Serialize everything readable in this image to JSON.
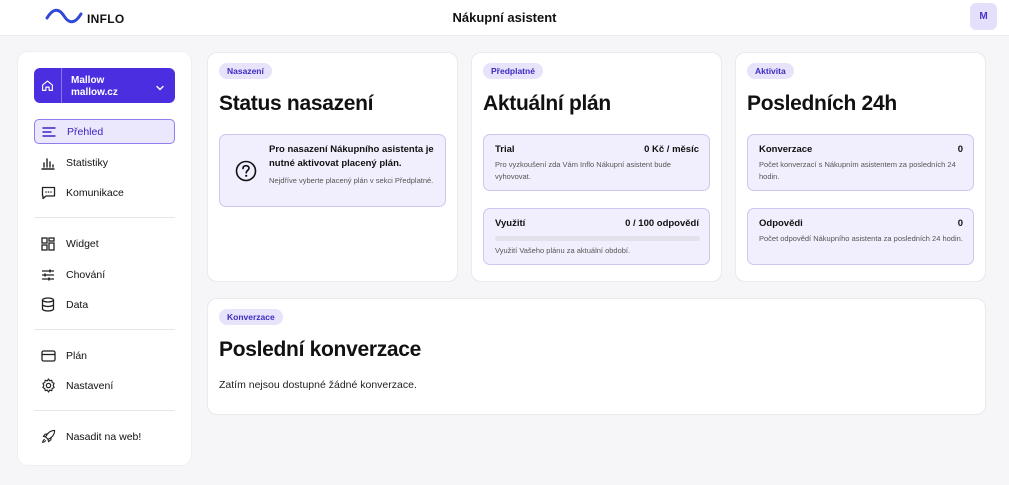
{
  "header": {
    "logo_text": "INFLO",
    "page_title": "Nákupní asistent",
    "avatar_initial": "M"
  },
  "sidebar": {
    "account": {
      "name": "Mallow",
      "domain": "mallow.cz"
    },
    "items": [
      {
        "label": "Přehled",
        "icon": "menu-lines-icon",
        "active": true
      },
      {
        "label": "Statistiky",
        "icon": "bar-chart-icon"
      },
      {
        "label": "Komunikace",
        "icon": "chat-icon"
      },
      {
        "label": "Widget",
        "icon": "widget-icon"
      },
      {
        "label": "Chování",
        "icon": "sliders-icon"
      },
      {
        "label": "Data",
        "icon": "database-icon"
      },
      {
        "label": "Plán",
        "icon": "credit-card-icon"
      },
      {
        "label": "Nastavení",
        "icon": "gear-icon"
      },
      {
        "label": "Nasadit na web!",
        "icon": "rocket-icon"
      }
    ]
  },
  "cards": {
    "deployment": {
      "badge": "Nasazení",
      "title": "Status nasazení",
      "notice_title": "Pro nasazení Nákupního asistenta je nutné aktivovat placený plán.",
      "notice_desc": "Nejdříve vyberte placený plán v sekci Předplatné."
    },
    "plan": {
      "badge": "Předplatné",
      "title": "Aktuální plán",
      "trial_label": "Trial",
      "trial_price": "0 Kč / měsíc",
      "trial_desc": "Pro vyzkoušení zda Vám Inflo Nákupní asistent bude vyhovovat.",
      "usage_label": "Využití",
      "usage_value": "0 / 100 odpovědí",
      "usage_fraction": 0,
      "usage_desc": "Využití Vašeho plánu za aktuální období."
    },
    "activity": {
      "badge": "Aktivita",
      "title": "Posledních 24h",
      "conversions_label": "Konverzace",
      "conversions_value": "0",
      "conversions_desc": "Počet konverzací s Nákupním asistentem za posledních 24 hodin.",
      "answers_label": "Odpovědi",
      "answers_value": "0",
      "answers_desc": "Počet odpovědí Nákupního asistenta za posledních 24 hodin."
    },
    "conversions": {
      "badge": "Konverzace",
      "title": "Poslední konverzace",
      "empty_text": "Zatím nejsou dostupné žádné konverzace."
    }
  },
  "colors": {
    "accent": "#4b2ee0",
    "accent_light": "#ebe7fd",
    "background": "#f6f6f8"
  }
}
